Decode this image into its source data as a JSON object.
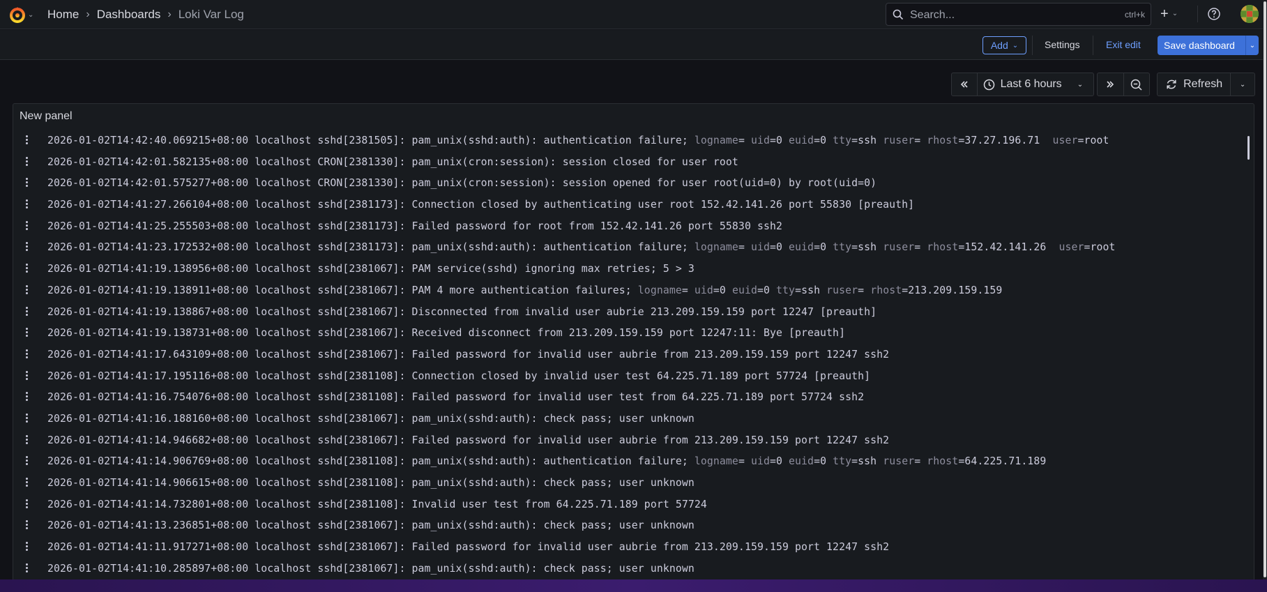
{
  "breadcrumb": {
    "home": "Home",
    "dashboards": "Dashboards",
    "current": "Loki Var Log"
  },
  "search": {
    "placeholder": "Search...",
    "shortcut": "ctrl+k"
  },
  "toolbar": {
    "add_label": "Add",
    "settings_label": "Settings",
    "exit_label": "Exit edit",
    "save_label": "Save dashboard"
  },
  "time": {
    "range_label": "Last 6 hours",
    "refresh_label": "Refresh"
  },
  "panel": {
    "title": "New panel"
  },
  "logs": [
    "2026-01-02T14:42:40.069215+08:00 localhost sshd[2381505]: pam_unix(sshd:auth): authentication failure; logname= uid=0 euid=0 tty=ssh ruser= rhost=37.27.196.71  user=root",
    "2026-01-02T14:42:01.582135+08:00 localhost CRON[2381330]: pam_unix(cron:session): session closed for user root",
    "2026-01-02T14:42:01.575277+08:00 localhost CRON[2381330]: pam_unix(cron:session): session opened for user root(uid=0) by root(uid=0)",
    "2026-01-02T14:41:27.266104+08:00 localhost sshd[2381173]: Connection closed by authenticating user root 152.42.141.26 port 55830 [preauth]",
    "2026-01-02T14:41:25.255503+08:00 localhost sshd[2381173]: Failed password for root from 152.42.141.26 port 55830 ssh2",
    "2026-01-02T14:41:23.172532+08:00 localhost sshd[2381173]: pam_unix(sshd:auth): authentication failure; logname= uid=0 euid=0 tty=ssh ruser= rhost=152.42.141.26  user=root",
    "2026-01-02T14:41:19.138956+08:00 localhost sshd[2381067]: PAM service(sshd) ignoring max retries; 5 > 3",
    "2026-01-02T14:41:19.138911+08:00 localhost sshd[2381067]: PAM 4 more authentication failures; logname= uid=0 euid=0 tty=ssh ruser= rhost=213.209.159.159",
    "2026-01-02T14:41:19.138867+08:00 localhost sshd[2381067]: Disconnected from invalid user aubrie 213.209.159.159 port 12247 [preauth]",
    "2026-01-02T14:41:19.138731+08:00 localhost sshd[2381067]: Received disconnect from 213.209.159.159 port 12247:11: Bye [preauth]",
    "2026-01-02T14:41:17.643109+08:00 localhost sshd[2381067]: Failed password for invalid user aubrie from 213.209.159.159 port 12247 ssh2",
    "2026-01-02T14:41:17.195116+08:00 localhost sshd[2381108]: Connection closed by invalid user test 64.225.71.189 port 57724 [preauth]",
    "2026-01-02T14:41:16.754076+08:00 localhost sshd[2381108]: Failed password for invalid user test from 64.225.71.189 port 57724 ssh2",
    "2026-01-02T14:41:16.188160+08:00 localhost sshd[2381067]: pam_unix(sshd:auth): check pass; user unknown",
    "2026-01-02T14:41:14.946682+08:00 localhost sshd[2381067]: Failed password for invalid user aubrie from 213.209.159.159 port 12247 ssh2",
    "2026-01-02T14:41:14.906769+08:00 localhost sshd[2381108]: pam_unix(sshd:auth): authentication failure; logname= uid=0 euid=0 tty=ssh ruser= rhost=64.225.71.189",
    "2026-01-02T14:41:14.906615+08:00 localhost sshd[2381108]: pam_unix(sshd:auth): check pass; user unknown",
    "2026-01-02T14:41:14.732801+08:00 localhost sshd[2381108]: Invalid user test from 64.225.71.189 port 57724",
    "2026-01-02T14:41:13.236851+08:00 localhost sshd[2381067]: pam_unix(sshd:auth): check pass; user unknown",
    "2026-01-02T14:41:11.917271+08:00 localhost sshd[2381067]: Failed password for invalid user aubrie from 213.209.159.159 port 12247 ssh2",
    "2026-01-02T14:41:10.285897+08:00 localhost sshd[2381067]: pam_unix(sshd:auth): check pass; user unknown"
  ],
  "colors": {
    "accent": "#3d71d9",
    "link": "#6e9fff",
    "background": "#111217",
    "panel": "#181b1f"
  },
  "icons": [
    "grafana-logo-icon",
    "search-icon",
    "plus-icon",
    "help-icon",
    "avatar",
    "time-back-icon",
    "clock-icon",
    "time-forward-icon",
    "zoom-out-icon",
    "refresh-icon",
    "log-menu-icon"
  ]
}
